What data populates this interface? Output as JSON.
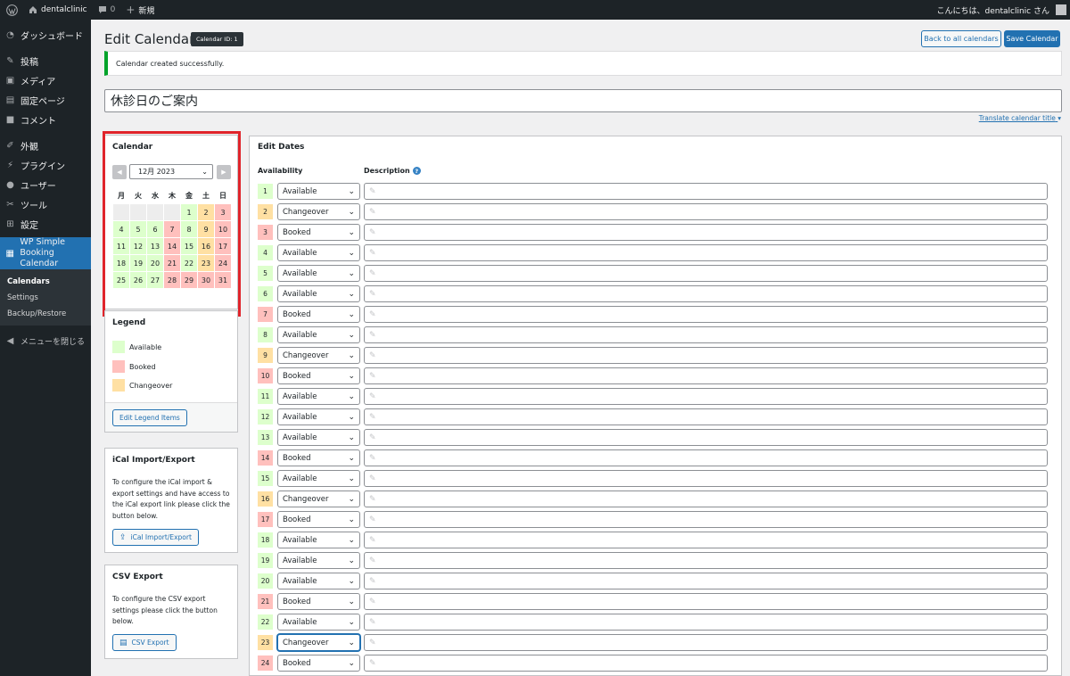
{
  "admin_bar": {
    "site_name": "dentalclinic",
    "comments_count": "0",
    "new_label": "新規",
    "greeting": "こんにちは、dentalclinic さん"
  },
  "sidebar": {
    "items": [
      {
        "label": "ダッシュボード",
        "icon": "dashboard-icon"
      },
      {
        "label": "投稿",
        "icon": "pin-icon"
      },
      {
        "label": "メディア",
        "icon": "media-icon"
      },
      {
        "label": "固定ページ",
        "icon": "page-icon"
      },
      {
        "label": "コメント",
        "icon": "comment-icon"
      },
      {
        "label": "外観",
        "icon": "brush-icon"
      },
      {
        "label": "プラグイン",
        "icon": "plugin-icon"
      },
      {
        "label": "ユーザー",
        "icon": "user-icon"
      },
      {
        "label": "ツール",
        "icon": "wrench-icon"
      },
      {
        "label": "設定",
        "icon": "settings-icon"
      }
    ],
    "current": {
      "label_line1": "WP Simple",
      "label_line2": "Booking Calendar",
      "icon": "calendar-icon"
    },
    "submenu": [
      "Calendars",
      "Settings",
      "Backup/Restore"
    ],
    "collapse_label": "メニューを閉じる"
  },
  "header": {
    "title": "Edit Calendar",
    "calendar_id_badge": "Calendar ID: 1",
    "back_button": "Back to all calendars",
    "save_button": "Save Calendar"
  },
  "notice": "Calendar created successfully.",
  "calendar_title_value": "休診日のご案内",
  "translate_link": "Translate calendar title",
  "calendar_panel": {
    "title": "Calendar",
    "month_select": "12月 2023",
    "weekdays": [
      "月",
      "火",
      "水",
      "木",
      "金",
      "土",
      "日"
    ],
    "leading_empty": 4,
    "days": [
      {
        "d": "1",
        "s": "available"
      },
      {
        "d": "2",
        "s": "changeover"
      },
      {
        "d": "3",
        "s": "booked"
      },
      {
        "d": "4",
        "s": "available"
      },
      {
        "d": "5",
        "s": "available"
      },
      {
        "d": "6",
        "s": "available"
      },
      {
        "d": "7",
        "s": "booked"
      },
      {
        "d": "8",
        "s": "available"
      },
      {
        "d": "9",
        "s": "changeover"
      },
      {
        "d": "10",
        "s": "booked"
      },
      {
        "d": "11",
        "s": "available"
      },
      {
        "d": "12",
        "s": "available"
      },
      {
        "d": "13",
        "s": "available"
      },
      {
        "d": "14",
        "s": "booked"
      },
      {
        "d": "15",
        "s": "available"
      },
      {
        "d": "16",
        "s": "changeover"
      },
      {
        "d": "17",
        "s": "booked"
      },
      {
        "d": "18",
        "s": "available"
      },
      {
        "d": "19",
        "s": "available"
      },
      {
        "d": "20",
        "s": "available"
      },
      {
        "d": "21",
        "s": "booked"
      },
      {
        "d": "22",
        "s": "available"
      },
      {
        "d": "23",
        "s": "changeover"
      },
      {
        "d": "24",
        "s": "booked"
      },
      {
        "d": "25",
        "s": "available"
      },
      {
        "d": "26",
        "s": "available"
      },
      {
        "d": "27",
        "s": "available"
      },
      {
        "d": "28",
        "s": "booked"
      },
      {
        "d": "29",
        "s": "booked"
      },
      {
        "d": "30",
        "s": "booked"
      },
      {
        "d": "31",
        "s": "booked"
      }
    ]
  },
  "legend": {
    "title": "Legend",
    "items": [
      {
        "label": "Available",
        "color": "#ddffcc"
      },
      {
        "label": "Booked",
        "color": "#ffc0bd"
      },
      {
        "label": "Changeover",
        "color": "#ffe0a3"
      }
    ],
    "edit_button": "Edit Legend Items"
  },
  "ical": {
    "title": "iCal Import/Export",
    "description": "To configure the iCal import & export settings and have access to the iCal export link please click the button below.",
    "button": "iCal Import/Export"
  },
  "csv": {
    "title": "CSV Export",
    "description": "To configure the CSV export settings please click the button below.",
    "button": "CSV Export"
  },
  "edit_dates": {
    "title": "Edit Dates",
    "availability_header": "Availability",
    "description_header": "Description",
    "rows": [
      {
        "day": "1",
        "status": "Available"
      },
      {
        "day": "2",
        "status": "Changeover"
      },
      {
        "day": "3",
        "status": "Booked"
      },
      {
        "day": "4",
        "status": "Available"
      },
      {
        "day": "5",
        "status": "Available"
      },
      {
        "day": "6",
        "status": "Available"
      },
      {
        "day": "7",
        "status": "Booked"
      },
      {
        "day": "8",
        "status": "Available"
      },
      {
        "day": "9",
        "status": "Changeover"
      },
      {
        "day": "10",
        "status": "Booked"
      },
      {
        "day": "11",
        "status": "Available"
      },
      {
        "day": "12",
        "status": "Available"
      },
      {
        "day": "13",
        "status": "Available"
      },
      {
        "day": "14",
        "status": "Booked"
      },
      {
        "day": "15",
        "status": "Available"
      },
      {
        "day": "16",
        "status": "Changeover"
      },
      {
        "day": "17",
        "status": "Booked"
      },
      {
        "day": "18",
        "status": "Available"
      },
      {
        "day": "19",
        "status": "Available"
      },
      {
        "day": "20",
        "status": "Available"
      },
      {
        "day": "21",
        "status": "Booked"
      },
      {
        "day": "22",
        "status": "Available"
      },
      {
        "day": "23",
        "status": "Changeover"
      },
      {
        "day": "24",
        "status": "Booked"
      }
    ],
    "focused_row_day": "23"
  },
  "colors": {
    "available": "#ddffcc",
    "booked": "#ffc0bd",
    "changeover": "#ffe0a3",
    "accent": "#2271b1",
    "highlight": "#e0242b"
  }
}
